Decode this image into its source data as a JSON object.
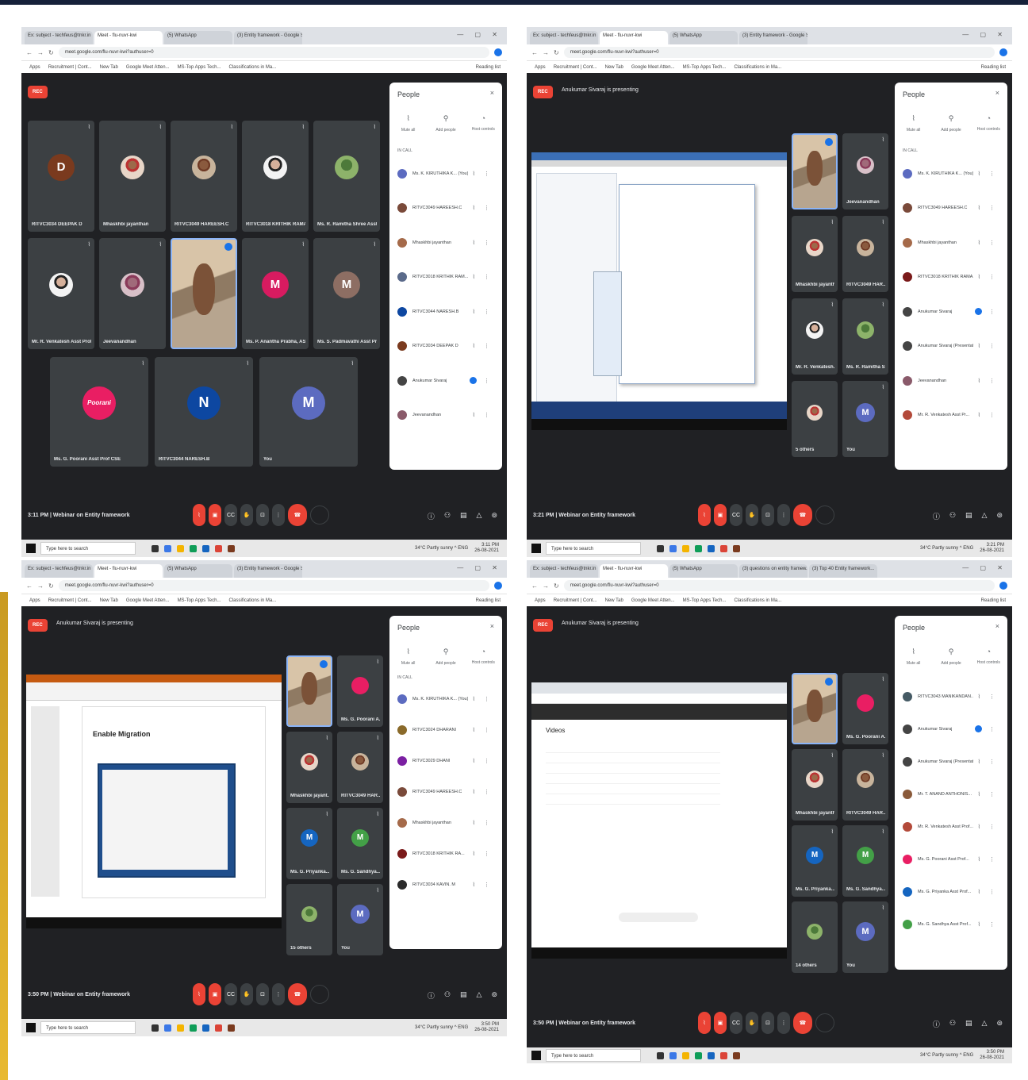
{
  "panels": [
    {
      "tabs": [
        "Ex: subject - techfeus@tnkr.in",
        "Meet - flu-nuvr-kwi",
        "",
        "(5) WhatsApp",
        "(3) Entity framework - Google Sear..."
      ],
      "address": "meet.google.com/flu-nuvr-kwi?authuser=0",
      "bookmarks": [
        "Apps",
        "Recruitment | Cont...",
        "New Tab",
        "Google Meet Atten...",
        "MS-Top Apps Tech...",
        "Classifications in Ma..."
      ],
      "reading_list": "Reading list",
      "rec": "REC",
      "presenting": "",
      "tiles": [
        {
          "name": "RITVC3034 DEEPAK D",
          "initial": "D",
          "color": "#7a3a1e"
        },
        {
          "name": "Mhaskhbi jayanthan",
          "initial": "",
          "color": ""
        },
        {
          "name": "RITVC3049 HAREESH.C",
          "initial": "",
          "color": ""
        },
        {
          "name": "RITVC3018 KRITHIK RAMA K.A.",
          "initial": "",
          "color": ""
        },
        {
          "name": "Ms. R. Ramitha Shree Asst P...",
          "initial": "",
          "color": ""
        },
        {
          "name": "Mr. R. Venkatesh Asst Prof ...",
          "initial": "",
          "color": ""
        },
        {
          "name": "Jeevanandhan",
          "initial": "",
          "color": ""
        },
        {
          "name": "",
          "initial": "",
          "color": ""
        },
        {
          "name": "Ms. P. Anantha Prabha, ASS...",
          "initial": "M",
          "color": "#d81b60"
        },
        {
          "name": "Ms. S. Padmavathi Asst Pro...",
          "initial": "M",
          "color": "#8d6e63"
        },
        {
          "name": "Ms. G. Poorani Asst Prof CSE",
          "initial": "Poorani",
          "color": "#e91e63"
        },
        {
          "name": "RITVC3044 NARESH.B",
          "initial": "N",
          "color": "#0d47a1"
        },
        {
          "name": "You",
          "initial": "M",
          "color": "#5c6bc0"
        }
      ],
      "people": [
        {
          "name": "Ms. K. KIRUTHIKA K... (You)",
          "color": "#5c6bc0"
        },
        {
          "name": "RITVC3049 HAREESH.C",
          "color": "#7a4a3a"
        },
        {
          "name": "Mhaskhbi jayanthan",
          "color": "#a56a4a"
        },
        {
          "name": "RITVC3018 KRITHIK RAM...",
          "color": "#5a6a8a"
        },
        {
          "name": "RITVC3044 NARESH.B",
          "color": "#0d47a1"
        },
        {
          "name": "RITVC3034 DEEPAK D",
          "color": "#7a3a1e"
        },
        {
          "name": "Anukumar Sivaraj",
          "color": "#444"
        },
        {
          "name": "Jeevanandhan",
          "color": "#8a5a6a"
        }
      ],
      "meeting_info": "3:11 PM | Webinar on Entity framework",
      "clock": [
        "3:11 PM",
        "26-08-2021"
      ]
    },
    {
      "tabs": [
        "Ex: subject - techfeus@tnkr.in",
        "Meet - flu-nuvr-kwi",
        "",
        "(5) WhatsApp",
        "(3) Entity framework - Google Sear..."
      ],
      "address": "meet.google.com/flu-nuvr-kwi?authuser=0",
      "bookmarks": [
        "Apps",
        "Recruitment | Cont...",
        "New Tab",
        "Google Meet Atten...",
        "MS-Top Apps Tech...",
        "Classifications in Ma..."
      ],
      "reading_list": "Reading list",
      "rec": "REC",
      "presenting": "Anukumar Sivaraj is presenting",
      "tiles": [
        {
          "name": "",
          "initial": "",
          "color": ""
        },
        {
          "name": "Jeevanandhan",
          "initial": "",
          "color": ""
        },
        {
          "name": "Mhaskhbi jayanth...",
          "initial": "",
          "color": ""
        },
        {
          "name": "RITVC3049 HAR...",
          "initial": "",
          "color": ""
        },
        {
          "name": "Mr. R. Venkatesh...",
          "initial": "",
          "color": ""
        },
        {
          "name": "Ms. R. Ramitha S...",
          "initial": "",
          "color": ""
        },
        {
          "name": "5 others",
          "initial": "",
          "color": ""
        },
        {
          "name": "You",
          "initial": "M",
          "color": "#5c6bc0"
        }
      ],
      "people": [
        {
          "name": "Ms. K. KIRUTHIKA K... (You)",
          "color": "#5c6bc0"
        },
        {
          "name": "RITVC3049 HAREESH.C",
          "color": "#7a4a3a"
        },
        {
          "name": "Mhaskhbi jayanthan",
          "color": "#a56a4a"
        },
        {
          "name": "RITVC3018 KRITHIK RAMA...",
          "color": "#7a1a1a"
        },
        {
          "name": "Anukumar Sivaraj",
          "color": "#444"
        },
        {
          "name": "Anukumar Sivaraj (Presentation)",
          "color": "#444"
        },
        {
          "name": "Jeevanandhan",
          "color": "#8a5a6a"
        },
        {
          "name": "Mr. R. Venkatesh Asst Pr...",
          "color": "#b34a3a"
        }
      ],
      "meeting_info": "3:21 PM | Webinar on Entity framework",
      "clock": [
        "3:21 PM",
        "26-08-2021"
      ]
    },
    {
      "tabs": [
        "Ex: subject - techfeus@tnkr.in",
        "Meet - flu-nuvr-kwi",
        "",
        "(5) WhatsApp",
        "(3) Entity framework - Google Sear..."
      ],
      "address": "meet.google.com/flu-nuvr-kwi?authuser=0",
      "bookmarks": [
        "Apps",
        "Recruitment | Cont...",
        "New Tab",
        "Google Meet Atten...",
        "MS-Top Apps Tech...",
        "Classifications in Ma..."
      ],
      "reading_list": "Reading list",
      "rec": "REC",
      "presenting": "Anukumar Sivaraj is presenting",
      "slide_title": "Enable Migration",
      "tiles": [
        {
          "name": "",
          "initial": "",
          "color": ""
        },
        {
          "name": "Ms. G. Poorani A...",
          "initial": "",
          "color": "#e91e63"
        },
        {
          "name": "Mhaskhbi jayant...",
          "initial": "",
          "color": ""
        },
        {
          "name": "RITVC3049 HAR...",
          "initial": "",
          "color": ""
        },
        {
          "name": "Ms. G. Priyanka...",
          "initial": "M",
          "color": "#1565c0"
        },
        {
          "name": "Ms. G. Sandhya...",
          "initial": "M",
          "color": "#43a047"
        },
        {
          "name": "15 others",
          "initial": "",
          "color": ""
        },
        {
          "name": "You",
          "initial": "M",
          "color": "#5c6bc0"
        }
      ],
      "people": [
        {
          "name": "Ms. K. KIRUTHIKA K... (You)",
          "color": "#5c6bc0"
        },
        {
          "name": "RITVC3024 DHARANI",
          "color": "#8a6a2a"
        },
        {
          "name": "RITVC3029 DHANI",
          "color": "#7b1fa2"
        },
        {
          "name": "RITVC3049 HAREESH.C",
          "color": "#7a4a3a"
        },
        {
          "name": "Mhaskhbi jayanthan",
          "color": "#a56a4a"
        },
        {
          "name": "RITVC3018 KRITHIK RA...",
          "color": "#7a1a1a"
        },
        {
          "name": "RITVC3034 KAVIN. M",
          "color": "#2a2a2a"
        },
        {
          "name": "RITVC3021 SHREE...",
          "color": "#555"
        }
      ],
      "meeting_info": "3:50 PM | Webinar on Entity framework",
      "clock": [
        "3:50 PM",
        "26-08-2021"
      ]
    },
    {
      "tabs": [
        "Ex: subject - techfeus@tnkr.in",
        "Meet - flu-nuvr-kwi",
        "",
        "(5) WhatsApp",
        "(3) questions on entity framew...",
        "(3) Top 40 Entity framework..."
      ],
      "address": "meet.google.com/flu-nuvr-kwi?authuser=0",
      "bookmarks": [
        "Apps",
        "Recruitment | Cont...",
        "New Tab",
        "Google Meet Atten...",
        "MS-Top Apps Tech...",
        "Classifications in Ma..."
      ],
      "reading_list": "Reading list",
      "rec": "REC",
      "presenting": "Anukumar Sivaraj is presenting",
      "share_heading": "Videos",
      "tiles": [
        {
          "name": "",
          "initial": "",
          "color": ""
        },
        {
          "name": "Ms. G. Poorani A...",
          "initial": "",
          "color": "#e91e63"
        },
        {
          "name": "Mhaskhbi jayanth...",
          "initial": "",
          "color": ""
        },
        {
          "name": "RITVC3049 HAR...",
          "initial": "",
          "color": ""
        },
        {
          "name": "Ms. G. Priyanka...",
          "initial": "M",
          "color": "#1565c0"
        },
        {
          "name": "Ms. G. Sandhya...",
          "initial": "M",
          "color": "#43a047"
        },
        {
          "name": "14 others",
          "initial": "",
          "color": ""
        },
        {
          "name": "You",
          "initial": "M",
          "color": "#5c6bc0"
        }
      ],
      "people": [
        {
          "name": "RITVC3043 MANIKANDAN...",
          "color": "#455a64"
        },
        {
          "name": "Anukumar Sivaraj",
          "color": "#444"
        },
        {
          "name": "Anukumar Sivaraj (Presentation)",
          "color": "#444"
        },
        {
          "name": "Mr. T. ANAND ANTHONIS...",
          "color": "#8a5a3a"
        },
        {
          "name": "Mr. R. Venkatesh Asst Prof...",
          "color": "#b34a3a"
        },
        {
          "name": "Ms. G. Poorani Asst Prof...",
          "color": "#e91e63"
        },
        {
          "name": "Ms. G. Priyanka Asst Prof...",
          "color": "#1565c0"
        },
        {
          "name": "Ms. G. Sandhya Asst Prof...",
          "color": "#43a047"
        }
      ],
      "meeting_info": "3:50 PM | Webinar on Entity framework",
      "clock": [
        "3:50 PM",
        "26-08-2021"
      ]
    }
  ],
  "common": {
    "people_title": "People",
    "in_meeting": "IN CALL",
    "actions": [
      "Mute all",
      "Add people",
      "Host controls"
    ],
    "taskbar_search": "Type here to search",
    "tray": "34°C Partly sunny  ^  ENG",
    "close_glyph": "×"
  }
}
